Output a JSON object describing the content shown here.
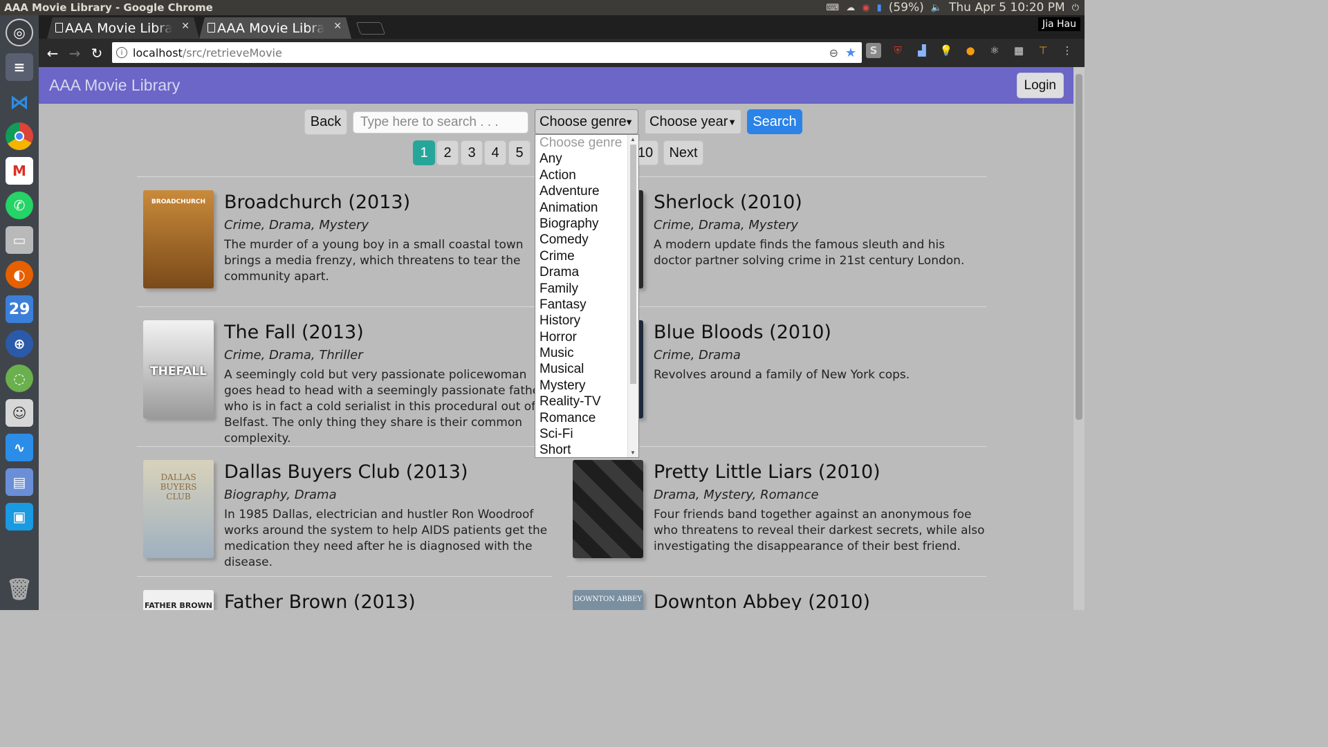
{
  "os": {
    "window_title": "AAA Movie Library - Google Chrome",
    "battery": "(59%)",
    "clock": "Thu Apr  5 10:20 PM",
    "calendar_day": "29"
  },
  "browser": {
    "tabs": [
      {
        "label": "AAA Movie Library"
      },
      {
        "label": "AAA Movie Library"
      }
    ],
    "user": "Jia Hau",
    "url_host": "localhost",
    "url_path": "/src/retrieveMovie"
  },
  "app": {
    "brand": "AAA Movie Library",
    "login_label": "Login"
  },
  "search": {
    "back_label": "Back",
    "placeholder": "Type here to search . . .",
    "genre_label": "Choose genre",
    "year_label": "Choose year",
    "search_label": "Search"
  },
  "pagination": {
    "pages": [
      "1",
      "2",
      "3",
      "4",
      "5",
      "10"
    ],
    "active": "1",
    "next_label": "Next"
  },
  "genre_dropdown": {
    "options": [
      "Choose genre",
      "Any",
      "Action",
      "Adventure",
      "Animation",
      "Biography",
      "Comedy",
      "Crime",
      "Drama",
      "Family",
      "Fantasy",
      "History",
      "Horror",
      "Music",
      "Musical",
      "Mystery",
      "Reality-TV",
      "Romance",
      "Sci-Fi",
      "Short"
    ]
  },
  "movies": [
    {
      "title": "Broadchurch (2013)",
      "genres": "Crime, Drama, Mystery",
      "description": "The murder of a young boy in a small coastal town brings a media frenzy, which threatens to tear the community apart.",
      "poster_text": "BROADCHURCH",
      "poster_color": "#c98a3a"
    },
    {
      "title": "Sherlock (2010)",
      "genres": "Crime, Drama, Mystery",
      "description": "A modern update finds the famous sleuth and his doctor partner solving crime in 21st century London.",
      "poster_text": "",
      "poster_color": "#2a2a2a"
    },
    {
      "title": "The Fall (2013)",
      "genres": "Crime, Drama, Thriller",
      "description": "A seemingly cold but very passionate policewoman goes head to head with a seemingly passionate father who is in fact a cold serialist in this procedural out of Belfast. The only thing they share is their common complexity.",
      "poster_text": "THEFALL",
      "poster_color": "#e6e6e6"
    },
    {
      "title": "Blue Bloods (2010)",
      "genres": "Crime, Drama",
      "description": "Revolves around a family of New York cops.",
      "poster_text": "",
      "poster_color": "#1e2a3a"
    },
    {
      "title": "Dallas Buyers Club (2013)",
      "genres": "Biography, Drama",
      "description": "In 1985 Dallas, electrician and hustler Ron Woodroof works around the system to help AIDS patients get the medication they need after he is diagnosed with the disease.",
      "poster_text": "DALLAS BUYERS CLUB",
      "poster_color": "#cfc8b0"
    },
    {
      "title": "Pretty Little Liars (2010)",
      "genres": "Drama, Mystery, Romance",
      "description": "Four friends band together against an anonymous foe who threatens to reveal their darkest secrets, while also investigating the disappearance of their best friend.",
      "poster_text": "",
      "poster_color": "#2e2e2e"
    },
    {
      "title": "Father Brown (2013)",
      "genres": "",
      "description": "",
      "poster_text": "FATHER BROWN",
      "poster_color": "#f0f0f0"
    },
    {
      "title": "Downton Abbey (2010)",
      "genres": "",
      "description": "",
      "poster_text": "DOWNTON ABBEY",
      "poster_color": "#7a8fa0"
    }
  ]
}
